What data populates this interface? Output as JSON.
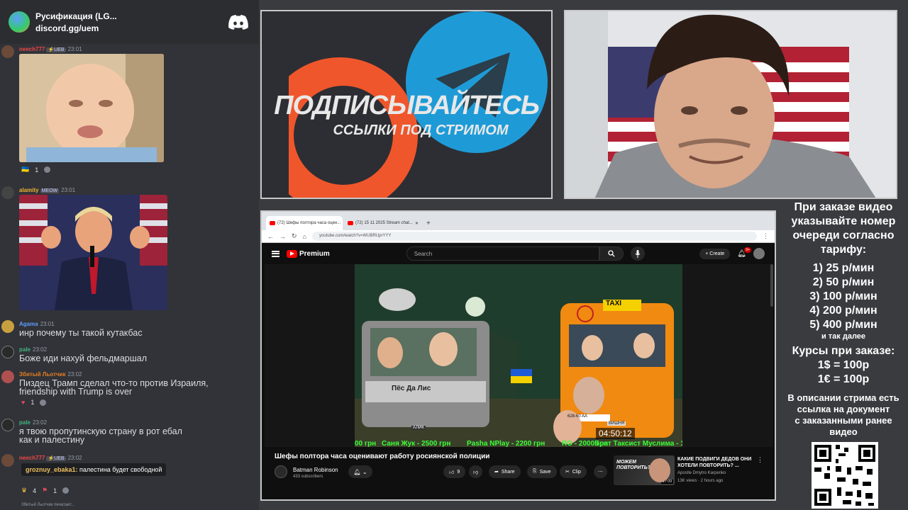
{
  "chat": {
    "server_name": "Русификация (LG...",
    "server_link": "discord.gg/uem",
    "messages": [
      {
        "user": "neech777",
        "user_color": "#f04747",
        "tag": "⚡UEB",
        "time": "23:01",
        "reaction_count": "1"
      },
      {
        "user": "alamity",
        "user_color": "#f0b232",
        "tag": "MEOW",
        "time": "23:01"
      },
      {
        "user": "Agama",
        "user_color": "#5865f2",
        "time": "23:01",
        "text": "инр почему ты такой кутакбас"
      },
      {
        "user": "pale",
        "user_color": "#43b581",
        "time": "23:02",
        "text": "Боже иди нахуй фельдмаршал"
      },
      {
        "user": "Збитый Льотчик",
        "user_color": "#e67e22",
        "time": "23:02",
        "text_line1": "Пиздец Трамп сделал что-то против Израиля,",
        "text_line2": "friendship with Trump is over",
        "reaction_count": "1"
      },
      {
        "user": "pale",
        "user_color": "#43b581",
        "time": "23:02",
        "text_line1": "я твою пропутинскую страну в рот ебал",
        "text_line2": "как и палестину"
      },
      {
        "user": "neech777",
        "user_color": "#f04747",
        "tag": "⚡UEB",
        "time": "23:02",
        "reply_user": "groznuy_ebaka1:",
        "reply_text": "палестина будет свободной",
        "reaction1_count": "4",
        "reaction2_count": "1"
      }
    ],
    "typing": "Збитый Льотчик печатает..."
  },
  "banner": {
    "title": "ПОДПИСЫВАЙТЕСЬ",
    "subtitle": "ССЫЛКИ ПОД СТРИМОМ",
    "patreon_color": "#f0562b",
    "telegram_color": "#1e9bd7"
  },
  "browser": {
    "tabs": [
      {
        "label": "(72) Шефы полтора часа оцен..."
      },
      {
        "label": "(72) 15 11 2025 Stream chat..."
      }
    ],
    "url": "youtube.com/watch?v=WUBRUprYYY",
    "youtube": {
      "logo": "Premium",
      "search_placeholder": "Search",
      "create_label": "Create",
      "notif_badge": "9+",
      "video_title": "Шефы полтора часа оценивают работу росиянской полиции",
      "channel_name": "Batman Robinson",
      "channel_subs": "433 subscribers",
      "like_count": "9",
      "share_label": "Share",
      "save_label": "Save",
      "clip_label": "Clip",
      "timer": "04:50:12",
      "overlay_van_text": "Пёс Да Лис",
      "overlay_taxi_text": "TAXI",
      "overlay_plate1": "628-60 AA",
      "overlay_label_alik": "АЛИК",
      "overlay_label_vishnya": "ВИШНЯ",
      "ticker": [
        "00 грн",
        "Саня Жук - 2500 грн",
        "Pasha NPlay - 2200 грн",
        "RO - 2000 грн",
        "Брат Таксист Муслима - 1"
      ],
      "side_video": {
        "title": "КАКИЕ ПОДВИГИ ДЕДОВ ОНИ ХОТЕЛИ ПОВТОРИТЬ? ...",
        "author": "Apostle Dmytro Karpenko",
        "views": "13K views · 2 hours ago",
        "thumb_text": "МОЖЕМ ПОВТОРИТЬ?",
        "thumb_duration": "27:09"
      }
    }
  },
  "prices": {
    "header": [
      "При заказе видео",
      "указывайте номер",
      "очереди согласно",
      "тарифу:"
    ],
    "tiers": [
      "1) 25 р/мин",
      "2) 50 р/мин",
      "3) 100 р/мин",
      "4) 200 р/мин",
      "5) 400 р/мин"
    ],
    "etc": "и так далее",
    "courses_title": "Курсы при заказе:",
    "usd": "1$ = 100р",
    "eur": "1€ = 100р",
    "note": [
      "В описании стрима есть",
      "ссылка на документ",
      "с заказанными ранее",
      "видео"
    ]
  }
}
